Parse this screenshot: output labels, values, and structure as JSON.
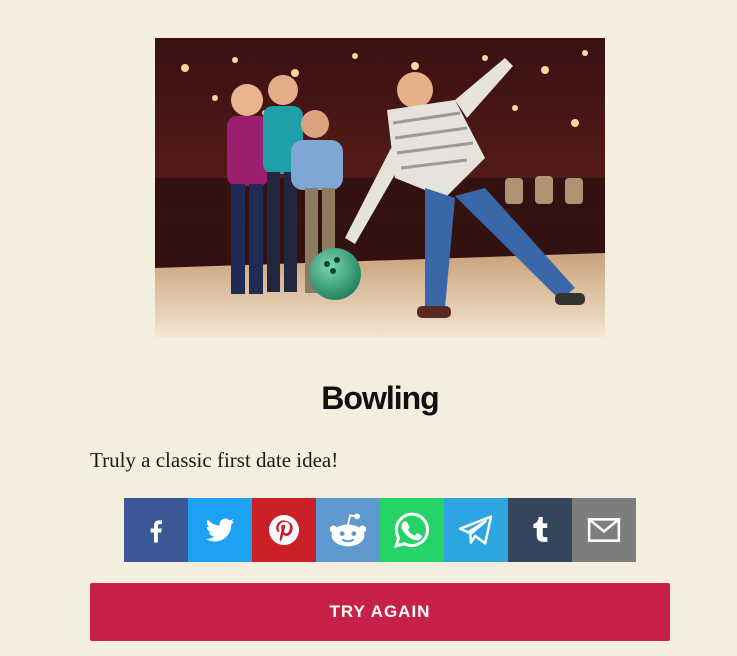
{
  "result": {
    "title": "Bowling",
    "description": "Truly a classic first date idea!",
    "image_subject": "group of friends bowling"
  },
  "share": {
    "buttons": [
      {
        "network": "facebook",
        "icon": "facebook-icon",
        "color": "#3b5998"
      },
      {
        "network": "twitter",
        "icon": "twitter-icon",
        "color": "#1da1f2"
      },
      {
        "network": "pinterest",
        "icon": "pinterest-icon",
        "color": "#cb2027"
      },
      {
        "network": "reddit",
        "icon": "reddit-icon",
        "color": "#5f99cf"
      },
      {
        "network": "whatsapp",
        "icon": "whatsapp-icon",
        "color": "#25d366"
      },
      {
        "network": "telegram",
        "icon": "telegram-icon",
        "color": "#2ca5e0"
      },
      {
        "network": "tumblr",
        "icon": "tumblr-icon",
        "color": "#35465c"
      },
      {
        "network": "email",
        "icon": "email-icon",
        "color": "#7d7d7d"
      }
    ]
  },
  "actions": {
    "try_again_label": "TRY AGAIN"
  },
  "colors": {
    "background": "#f3eedd",
    "accent": "#c72148"
  }
}
